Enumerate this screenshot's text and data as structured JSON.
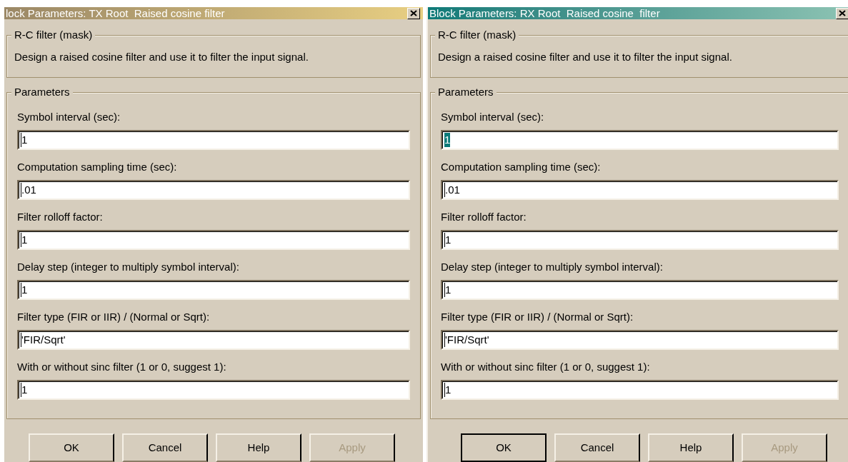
{
  "windows": [
    {
      "title": "lock Parameters: TX Root  Raised cosine filter",
      "active": false,
      "mask_group": {
        "label": "R-C filter (mask)",
        "description": "Design a raised cosine filter and use it to filter the input signal."
      },
      "parameters_group": {
        "label": "Parameters",
        "fields": [
          {
            "label": "Symbol interval (sec):",
            "value": "1",
            "text_selected": false
          },
          {
            "label": "Computation sampling time (sec):",
            "value": ".01",
            "text_selected": false
          },
          {
            "label": "Filter rolloff factor:",
            "value": "1",
            "text_selected": false
          },
          {
            "label": "Delay step (integer to multiply symbol interval):",
            "value": "1",
            "text_selected": false
          },
          {
            "label": "Filter type (FIR or IIR) / (Normal or Sqrt):",
            "value": "'FIR/Sqrt'",
            "text_selected": false
          },
          {
            "label": "With or without sinc filter (1 or 0, suggest 1):",
            "value": "1",
            "text_selected": false
          }
        ]
      },
      "buttons": [
        {
          "label": "OK",
          "default": false,
          "disabled": false
        },
        {
          "label": "Cancel",
          "default": false,
          "disabled": false
        },
        {
          "label": "Help",
          "default": false,
          "disabled": false
        },
        {
          "label": "Apply",
          "default": false,
          "disabled": true
        }
      ]
    },
    {
      "title": "Block Parameters: RX Root  Raised cosine  filter",
      "active": true,
      "mask_group": {
        "label": "R-C filter (mask)",
        "description": "Design a raised cosine filter and use it to filter the input signal."
      },
      "parameters_group": {
        "label": "Parameters",
        "fields": [
          {
            "label": "Symbol interval (sec):",
            "value": "1",
            "text_selected": true
          },
          {
            "label": "Computation sampling time (sec):",
            "value": ".01",
            "text_selected": false
          },
          {
            "label": "Filter rolloff factor:",
            "value": "1",
            "text_selected": false
          },
          {
            "label": "Delay step (integer to multiply symbol interval):",
            "value": "1",
            "text_selected": false
          },
          {
            "label": "Filter type (FIR or IIR) / (Normal or Sqrt):",
            "value": "'FIR/Sqrt'",
            "text_selected": false
          },
          {
            "label": "With or without sinc filter (1 or 0, suggest 1):",
            "value": "1",
            "text_selected": false
          }
        ]
      },
      "buttons": [
        {
          "label": "OK",
          "default": true,
          "disabled": false
        },
        {
          "label": "Cancel",
          "default": false,
          "disabled": false
        },
        {
          "label": "Help",
          "default": false,
          "disabled": false
        },
        {
          "label": "Apply",
          "default": false,
          "disabled": true
        }
      ]
    }
  ]
}
